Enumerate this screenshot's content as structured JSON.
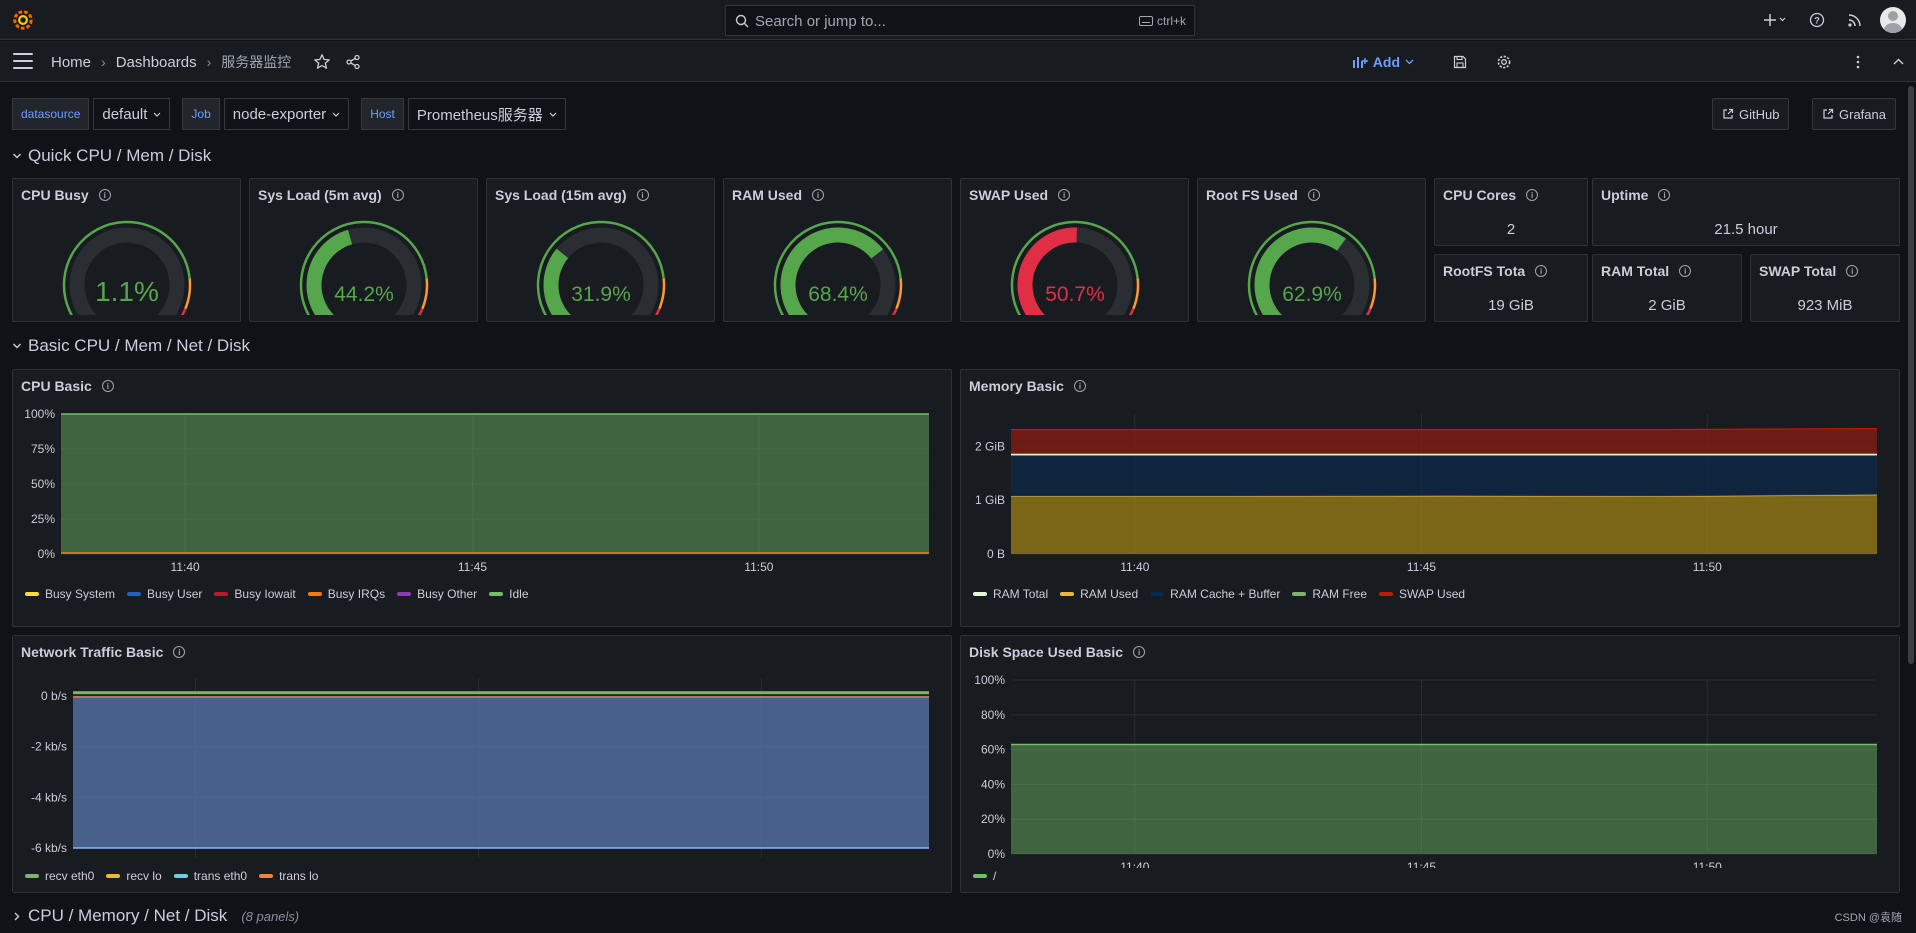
{
  "topbar": {
    "search_placeholder": "Search or jump to...",
    "search_shortcut": "ctrl+k"
  },
  "breadcrumb": {
    "home": "Home",
    "dashboards": "Dashboards",
    "current": "服务器监控"
  },
  "toolbar": {
    "add_label": "Add"
  },
  "variables": [
    {
      "label": "datasource",
      "value": "default"
    },
    {
      "label": "Job",
      "value": "node-exporter"
    },
    {
      "label": "Host",
      "value": "Prometheus服务器"
    }
  ],
  "links": {
    "github": "GitHub",
    "grafana": "Grafana"
  },
  "rows": {
    "quick": "Quick CPU / Mem / Disk",
    "basic": "Basic CPU / Mem / Net / Disk",
    "collapsed": "CPU / Memory / Net / Disk",
    "collapsed_count": "(8 panels)"
  },
  "gauges": [
    {
      "title": "CPU Busy",
      "value": "1.1%",
      "level": 0.011,
      "color": "#56a64b"
    },
    {
      "title": "Sys Load (5m avg)",
      "value": "44.2%",
      "level": 0.442,
      "color": "#56a64b"
    },
    {
      "title": "Sys Load (15m avg)",
      "value": "31.9%",
      "level": 0.319,
      "color": "#56a64b"
    },
    {
      "title": "RAM Used",
      "value": "68.4%",
      "level": 0.684,
      "color": "#56a64b"
    },
    {
      "title": "SWAP Used",
      "value": "50.7%",
      "level": 0.507,
      "color": "#e02f44"
    },
    {
      "title": "Root FS Used",
      "value": "62.9%",
      "level": 0.629,
      "color": "#56a64b"
    }
  ],
  "stats": {
    "cpu_cores": {
      "title": "CPU Cores",
      "value": "2"
    },
    "uptime": {
      "title": "Uptime",
      "value": "21.5 hour"
    },
    "rootfs_total": {
      "title": "RootFS Tota",
      "value": "19 GiB"
    },
    "ram_total": {
      "title": "RAM Total",
      "value": "2 GiB"
    },
    "swap_total": {
      "title": "SWAP Total",
      "value": "923 MiB"
    }
  },
  "panels": {
    "cpu_basic": {
      "title": "CPU Basic",
      "yticks": [
        "100%",
        "75%",
        "50%",
        "25%",
        "0%"
      ],
      "xticks": [
        "11:40",
        "11:45",
        "11:50"
      ],
      "legend": [
        {
          "name": "Busy System",
          "color": "#fade2a"
        },
        {
          "name": "Busy User",
          "color": "#1f60c4"
        },
        {
          "name": "Busy Iowait",
          "color": "#c4162a"
        },
        {
          "name": "Busy IRQs",
          "color": "#ff780a"
        },
        {
          "name": "Busy Other",
          "color": "#8f3bb8"
        },
        {
          "name": "Idle",
          "color": "#73bf69"
        }
      ]
    },
    "memory_basic": {
      "title": "Memory Basic",
      "yticks": [
        "2 GiB",
        "1 GiB",
        "0 B"
      ],
      "xticks": [
        "11:40",
        "11:45",
        "11:50"
      ],
      "legend": [
        {
          "name": "RAM Total",
          "color": "#e0f9d7"
        },
        {
          "name": "RAM Used",
          "color": "#eab839"
        },
        {
          "name": "RAM Cache + Buffer",
          "color": "#052b51"
        },
        {
          "name": "RAM Free",
          "color": "#7eb26d"
        },
        {
          "name": "SWAP Used",
          "color": "#bf1b00"
        }
      ]
    },
    "network_basic": {
      "title": "Network Traffic Basic",
      "yticks": [
        "0 b/s",
        "-2 kb/s",
        "-4 kb/s",
        "-6 kb/s"
      ],
      "xticks": [
        "11:40",
        "11:45",
        "11:50"
      ],
      "legend": [
        {
          "name": "recv eth0",
          "color": "#7eb26d"
        },
        {
          "name": "recv lo",
          "color": "#eab839"
        },
        {
          "name": "trans eth0",
          "color": "#6ed0e0"
        },
        {
          "name": "trans lo",
          "color": "#ef843c"
        }
      ]
    },
    "disk_basic": {
      "title": "Disk Space Used Basic",
      "yticks": [
        "100%",
        "80%",
        "60%",
        "40%",
        "20%",
        "0%"
      ],
      "xticks": [
        "11:40",
        "11:45",
        "11:50"
      ],
      "legend": [
        {
          "name": "/",
          "color": "#73bf69"
        }
      ]
    }
  },
  "chart_data": [
    {
      "type": "area",
      "title": "CPU Basic",
      "x": [
        "11:36",
        "11:40",
        "11:45",
        "11:50",
        "11:53"
      ],
      "ylim": [
        0,
        100
      ],
      "series": [
        {
          "name": "Busy System",
          "values": [
            0.5,
            0.5,
            0.5,
            0.5,
            0.5
          ]
        },
        {
          "name": "Busy User",
          "values": [
            0.5,
            0.5,
            0.5,
            0.5,
            0.5
          ]
        },
        {
          "name": "Busy Iowait",
          "values": [
            0,
            0,
            0,
            0,
            0
          ]
        },
        {
          "name": "Busy IRQs",
          "values": [
            0.1,
            0.1,
            0.1,
            0.1,
            0.1
          ]
        },
        {
          "name": "Busy Other",
          "values": [
            0,
            0,
            0,
            0,
            0
          ]
        },
        {
          "name": "Idle",
          "values": [
            98.9,
            98.9,
            98.9,
            98.9,
            98.9
          ]
        }
      ]
    },
    {
      "type": "area",
      "title": "Memory Basic",
      "x": [
        "11:36",
        "11:40",
        "11:45",
        "11:50",
        "11:53"
      ],
      "ylabel": "GiB",
      "ylim": [
        0,
        2.6
      ],
      "series": [
        {
          "name": "RAM Total",
          "values": [
            1.85,
            1.85,
            1.85,
            1.85,
            1.85
          ]
        },
        {
          "name": "RAM Used",
          "values": [
            1.07,
            1.07,
            1.08,
            1.07,
            1.1
          ]
        },
        {
          "name": "RAM Cache + Buffer",
          "values": [
            0.75,
            0.75,
            0.74,
            0.75,
            0.72
          ]
        },
        {
          "name": "RAM Free",
          "values": [
            0.03,
            0.03,
            0.03,
            0.03,
            0.03
          ]
        },
        {
          "name": "SWAP Used",
          "values": [
            0.46,
            0.46,
            0.46,
            0.46,
            0.48
          ]
        }
      ]
    },
    {
      "type": "area",
      "title": "Network Traffic Basic",
      "x": [
        "11:36",
        "11:40",
        "11:45",
        "11:50",
        "11:53"
      ],
      "ylim": [
        -6,
        0.6
      ],
      "series": [
        {
          "name": "recv eth0",
          "values": [
            0.15,
            0.15,
            0.2,
            0.15,
            0.15
          ]
        },
        {
          "name": "recv lo",
          "values": [
            0,
            0,
            0,
            0,
            0
          ]
        },
        {
          "name": "trans eth0",
          "values": [
            -6,
            -6,
            -6,
            -6,
            -6
          ]
        },
        {
          "name": "trans lo",
          "values": [
            0,
            0,
            0,
            0,
            0
          ]
        }
      ]
    },
    {
      "type": "area",
      "title": "Disk Space Used Basic",
      "x": [
        "11:36",
        "11:40",
        "11:45",
        "11:50",
        "11:53"
      ],
      "ylim": [
        0,
        100
      ],
      "series": [
        {
          "name": "/",
          "values": [
            62.9,
            62.9,
            62.9,
            62.9,
            62.9
          ]
        }
      ]
    }
  ],
  "footer": "CSDN @袁随"
}
